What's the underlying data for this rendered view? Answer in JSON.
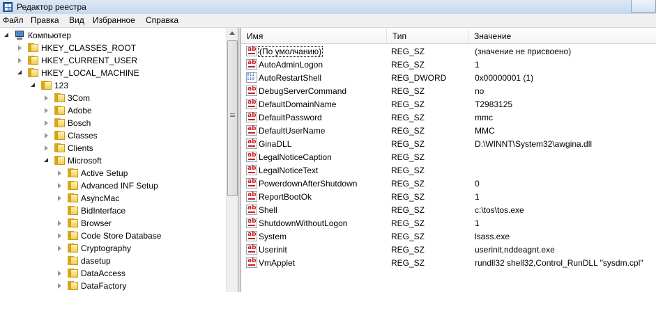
{
  "window": {
    "title": "Редактор реестра"
  },
  "menu": [
    "Файл",
    "Правка",
    "Вид",
    "Избранное",
    "Справка"
  ],
  "tree": [
    {
      "label": "Компьютер",
      "icon": "computer-icon",
      "state": "expanded",
      "level": 0
    },
    {
      "label": "HKEY_CLASSES_ROOT",
      "icon": "folder-icon",
      "state": "collapsed",
      "level": 1
    },
    {
      "label": "HKEY_CURRENT_USER",
      "icon": "folder-icon",
      "state": "collapsed",
      "level": 1
    },
    {
      "label": "HKEY_LOCAL_MACHINE",
      "icon": "folder-icon",
      "state": "expanded",
      "level": 1
    },
    {
      "label": "123",
      "icon": "folder-icon",
      "state": "expanded",
      "level": 2
    },
    {
      "label": "3Com",
      "icon": "folder-icon",
      "state": "collapsed",
      "level": 3
    },
    {
      "label": "Adobe",
      "icon": "folder-icon",
      "state": "collapsed",
      "level": 3
    },
    {
      "label": "Bosch",
      "icon": "folder-icon",
      "state": "collapsed",
      "level": 3
    },
    {
      "label": "Classes",
      "icon": "folder-icon",
      "state": "collapsed",
      "level": 3
    },
    {
      "label": "Clients",
      "icon": "folder-icon",
      "state": "collapsed",
      "level": 3
    },
    {
      "label": "Microsoft",
      "icon": "folder-icon",
      "state": "expanded",
      "level": 3
    },
    {
      "label": "Active Setup",
      "icon": "folder-icon",
      "state": "collapsed",
      "level": 4
    },
    {
      "label": "Advanced INF Setup",
      "icon": "folder-icon",
      "state": "collapsed",
      "level": 4
    },
    {
      "label": "AsyncMac",
      "icon": "folder-icon",
      "state": "collapsed",
      "level": 4
    },
    {
      "label": "BidInterface",
      "icon": "folder-icon",
      "state": "none",
      "level": 4
    },
    {
      "label": "Browser",
      "icon": "folder-icon",
      "state": "collapsed",
      "level": 4
    },
    {
      "label": "Code Store Database",
      "icon": "folder-icon",
      "state": "collapsed",
      "level": 4
    },
    {
      "label": "Cryptography",
      "icon": "folder-icon",
      "state": "collapsed",
      "level": 4
    },
    {
      "label": "dasetup",
      "icon": "folder-icon",
      "state": "none",
      "level": 4
    },
    {
      "label": "DataAccess",
      "icon": "folder-icon",
      "state": "collapsed",
      "level": 4
    },
    {
      "label": "DataFactory",
      "icon": "folder-icon",
      "state": "collapsed",
      "level": 4
    }
  ],
  "columns": {
    "name": "Имя",
    "type": "Тип",
    "value": "Значение"
  },
  "values": [
    {
      "name": "(По умолчанию)",
      "type": "REG_SZ",
      "data": "(значение не присвоено)",
      "icon": "string-value-icon"
    },
    {
      "name": "AutoAdminLogon",
      "type": "REG_SZ",
      "data": "1",
      "icon": "string-value-icon"
    },
    {
      "name": "AutoRestartShell",
      "type": "REG_DWORD",
      "data": "0x00000001 (1)",
      "icon": "dword-value-icon"
    },
    {
      "name": "DebugServerCommand",
      "type": "REG_SZ",
      "data": "no",
      "icon": "string-value-icon"
    },
    {
      "name": "DefaultDomainName",
      "type": "REG_SZ",
      "data": "T2983125",
      "icon": "string-value-icon"
    },
    {
      "name": "DefaultPassword",
      "type": "REG_SZ",
      "data": "mmc",
      "icon": "string-value-icon"
    },
    {
      "name": "DefaultUserName",
      "type": "REG_SZ",
      "data": "MMC",
      "icon": "string-value-icon"
    },
    {
      "name": "GinaDLL",
      "type": "REG_SZ",
      "data": "D:\\WINNT\\System32\\awgina.dll",
      "icon": "string-value-icon"
    },
    {
      "name": "LegalNoticeCaption",
      "type": "REG_SZ",
      "data": "",
      "icon": "string-value-icon"
    },
    {
      "name": "LegalNoticeText",
      "type": "REG_SZ",
      "data": "",
      "icon": "string-value-icon"
    },
    {
      "name": "PowerdownAfterShutdown",
      "type": "REG_SZ",
      "data": "0",
      "icon": "string-value-icon"
    },
    {
      "name": "ReportBootOk",
      "type": "REG_SZ",
      "data": "1",
      "icon": "string-value-icon"
    },
    {
      "name": "Shell",
      "type": "REG_SZ",
      "data": "c:\\tos\\tos.exe",
      "icon": "string-value-icon"
    },
    {
      "name": "ShutdownWithoutLogon",
      "type": "REG_SZ",
      "data": "1",
      "icon": "string-value-icon"
    },
    {
      "name": "System",
      "type": "REG_SZ",
      "data": "lsass.exe",
      "icon": "string-value-icon"
    },
    {
      "name": "Userinit",
      "type": "REG_SZ",
      "data": "userinit,nddeagnt.exe",
      "icon": "string-value-icon"
    },
    {
      "name": "VmApplet",
      "type": "REG_SZ",
      "data": "rundll32 shell32,Control_RunDLL \"sysdm.cpl\"",
      "icon": "string-value-icon"
    }
  ]
}
